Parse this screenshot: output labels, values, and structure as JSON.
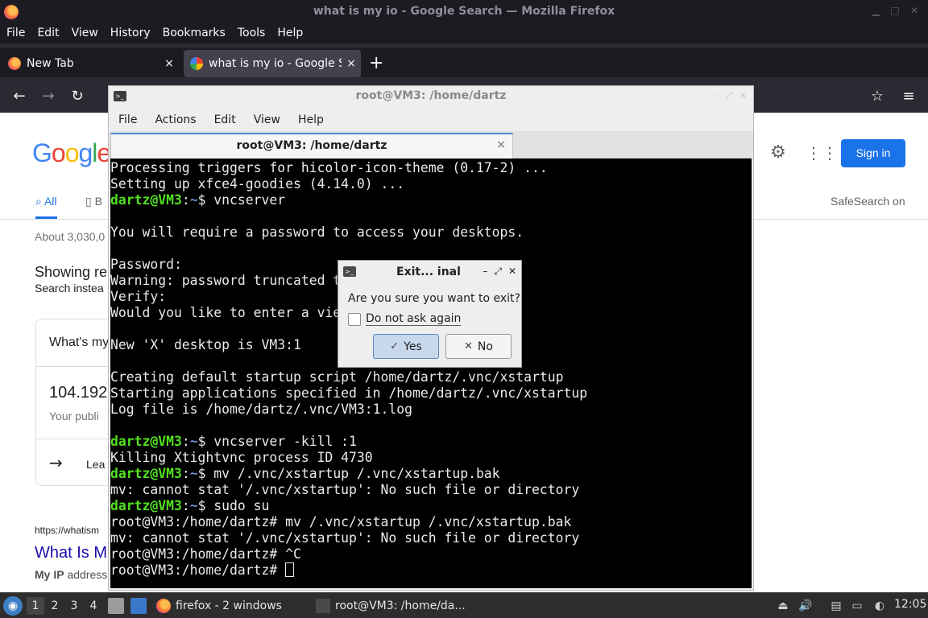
{
  "firefox": {
    "window_title": "what is my io - Google Search — Mozilla Firefox",
    "menu": [
      "File",
      "Edit",
      "View",
      "History",
      "Bookmarks",
      "Tools",
      "Help"
    ],
    "tabs": [
      {
        "label": "New Tab",
        "close": "×"
      },
      {
        "label": "what is my io - Google Search",
        "close": "×"
      }
    ],
    "new_tab_symbol": "+"
  },
  "google": {
    "logo": "Google",
    "signin_label": "Sign in",
    "tab_all": "All",
    "tab_b": "B",
    "safesearch": "SafeSearch on",
    "about": "About 3,030,0",
    "showing": "Showing re",
    "search_instead": "Search instea",
    "card_question": "What's my",
    "card_ip": "104.192",
    "card_sub": "Your publi",
    "card_learn": "Lea",
    "result_url": "https://whatism",
    "result_title": "What Is M",
    "result_snip_bold": "My IP",
    "result_snip_rest": " address"
  },
  "terminal": {
    "window_title": "root@VM3: /home/dartz",
    "menu": [
      "File",
      "Actions",
      "Edit",
      "View",
      "Help"
    ],
    "tab_label": "root@VM3: /home/dartz",
    "tab_close": "×",
    "lines": [
      {
        "type": "out",
        "text": "Processing triggers for hicolor-icon-theme (0.17-2) ..."
      },
      {
        "type": "out",
        "text": "Setting up xfce4-goodies (4.14.0) ..."
      },
      {
        "type": "prompt",
        "user": "dartz@VM3",
        "sep": ":",
        "path": "~",
        "sym": "$ ",
        "cmd": "vncserver"
      },
      {
        "type": "out",
        "text": ""
      },
      {
        "type": "out",
        "text": "You will require a password to access your desktops."
      },
      {
        "type": "out",
        "text": ""
      },
      {
        "type": "out",
        "text": "Password:"
      },
      {
        "type": "out",
        "text": "Warning: password truncated t"
      },
      {
        "type": "out",
        "text": "Verify:"
      },
      {
        "type": "out",
        "text": "Would you like to enter a vie"
      },
      {
        "type": "out",
        "text": ""
      },
      {
        "type": "out",
        "text": "New 'X' desktop is VM3:1"
      },
      {
        "type": "out",
        "text": ""
      },
      {
        "type": "out",
        "text": "Creating default startup script /home/dartz/.vnc/xstartup"
      },
      {
        "type": "out",
        "text": "Starting applications specified in /home/dartz/.vnc/xstartup"
      },
      {
        "type": "out",
        "text": "Log file is /home/dartz/.vnc/VM3:1.log"
      },
      {
        "type": "out",
        "text": ""
      },
      {
        "type": "prompt",
        "user": "dartz@VM3",
        "sep": ":",
        "path": "~",
        "sym": "$ ",
        "cmd": "vncserver -kill :1"
      },
      {
        "type": "out",
        "text": "Killing Xtightvnc process ID 4730"
      },
      {
        "type": "prompt",
        "user": "dartz@VM3",
        "sep": ":",
        "path": "~",
        "sym": "$ ",
        "cmd": "mv /.vnc/xstartup /.vnc/xstartup.bak"
      },
      {
        "type": "out",
        "text": "mv: cannot stat '/.vnc/xstartup': No such file or directory"
      },
      {
        "type": "prompt",
        "user": "dartz@VM3",
        "sep": ":",
        "path": "~",
        "sym": "$ ",
        "cmd": "sudo su"
      },
      {
        "type": "out",
        "text": "root@VM3:/home/dartz# mv /.vnc/xstartup /.vnc/xstartup.bak"
      },
      {
        "type": "out",
        "text": "mv: cannot stat '/.vnc/xstartup': No such file or directory"
      },
      {
        "type": "out",
        "text": "root@VM3:/home/dartz# ^C"
      },
      {
        "type": "cursor",
        "text": "root@VM3:/home/dartz# "
      }
    ]
  },
  "dialog": {
    "title": "Exit... inal",
    "message": "Are you sure you want to exit?",
    "checkbox_label": "Do not ask again",
    "checkbox_checked": false,
    "yes_label": "Yes",
    "no_label": "No"
  },
  "taskbar": {
    "workspaces": [
      "1",
      "2",
      "3",
      "4"
    ],
    "tasks": [
      "firefox - 2 windows",
      "root@VM3: /home/da..."
    ],
    "clock": "12:05"
  }
}
